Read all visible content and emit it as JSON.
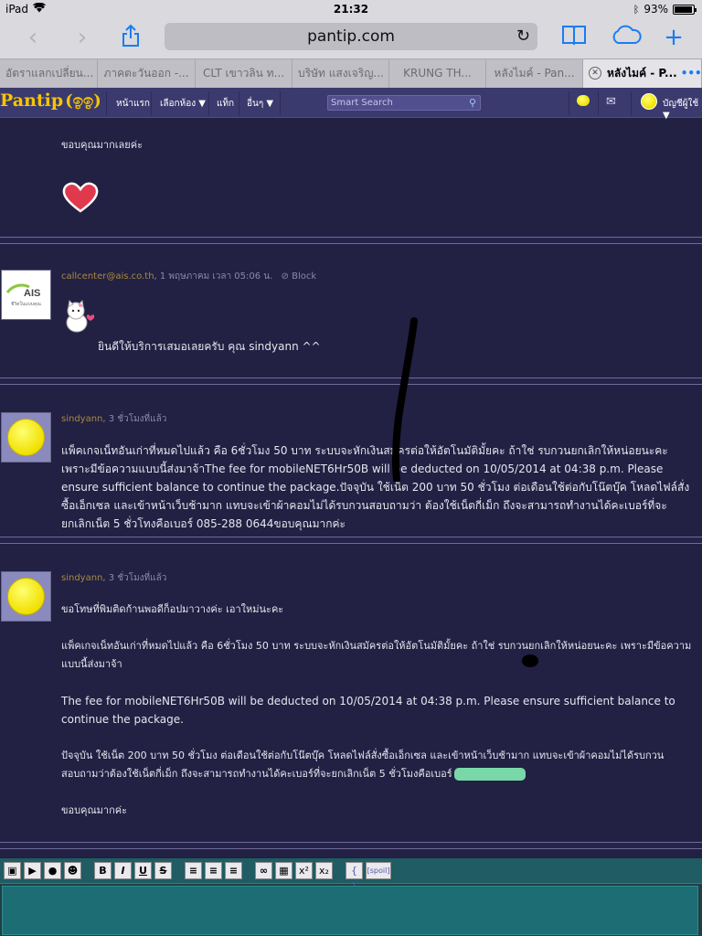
{
  "status_bar": {
    "device": "iPad",
    "time": "21:32",
    "battery": "93%"
  },
  "browser": {
    "url": "pantip.com",
    "icons": [
      "back-icon",
      "forward-icon",
      "share-icon",
      "bookmarks-icon",
      "icloud-icon",
      "new-tab-icon"
    ],
    "tabs": [
      {
        "label": "อัตราแลกเปลี่ยน...",
        "active": false
      },
      {
        "label": "ภาคตะวันออก -...",
        "active": false
      },
      {
        "label": "CLT เขาวลิน ท...",
        "active": false
      },
      {
        "label": "บริษัท แสงเจริญ...",
        "active": false
      },
      {
        "label": "KRUNG TH...",
        "active": false
      },
      {
        "label": "หลังไมค์ - Pan...",
        "active": false
      },
      {
        "label": "หลังไมค์ - P...",
        "active": true
      }
    ]
  },
  "nav": {
    "logo": "Pantip",
    "logo_mark": "(ඉඉ)",
    "home": "หน้าแรก",
    "rooms": "เลือกห้อง ▼",
    "tags": "แท็ก",
    "more": "อื่นๆ ▼",
    "search_placeholder": "Smart Search",
    "account": "บัญชีผู้ใช้ ▼"
  },
  "posts": [
    {
      "id": "post-top",
      "body": "ขอบคุณมากเลยค่ะ",
      "sticker": "heart"
    },
    {
      "id": "post-ais",
      "author": "callcenter@ais.co.th",
      "time": ", 1 พฤษภาคม เวลา 05:06 น.",
      "block_label": "Block",
      "avatar_text": "AIS",
      "avatar_sub": "ชีวิตในแบบคุณ",
      "body": "ยินดีให้บริการเสมอเลยครับ คุณ sindyann ^^"
    },
    {
      "id": "post-sindyann-1",
      "author": "sindyann",
      "time": ", 3 ชั่วโมงที่แล้ว",
      "body": "แพ็คเกจเน็ทอันเก่าที่หมดไปแล้ว คือ 6ชั่วโมง 50 บาท ระบบจะหักเงินสมัครต่อให้อัตโนมัติมั้ยคะ  ถ้าใช่ รบกวนยกเลิกให้หน่อยนะคะ  เพราะมีข้อความแบบนี้ส่งมาจ้าThe fee for mobileNET6Hr50B will be deducted on 10/05/2014 at 04:38 p.m. Please ensure sufficient balance to continue the package.ปัจจุบัน ใช้เน็ต 200 บาท 50 ชั่วโมง ต่อเดือนใช้ต่อกับโน๊ตบุ๊ค โหลดไฟล์สั่งซื้อเอ็กเซล และเข้าหน้าเว็บช้ามาก แทบจะเข้าผ้าคอมไม่ได้รบกวนสอบถามว่า ต้องใช้เน็ตกี่เม็ก ถึงจะสามารถทำงานได้คะเบอร์ที่จะยกเลิกเน็ต 5 ชั่วโทงคือเบอร์ 085-288 0644ขอบคุณมากค่ะ"
    },
    {
      "id": "post-sindyann-2",
      "author": "sindyann",
      "time": ", 3 ชั่วโมงที่แล้ว",
      "para1": "ขอโทษที่พิมติดก้านพอดีก็อปมาวางค่ะ เอาใหม่นะคะ",
      "para2": "แพ็คเกจเน็ทอันเก่าที่หมดไปแล้ว คือ 6ชั่วโมง 50 บาท ระบบจะหักเงินสมัครต่อให้อัตโนมัติมั้ยคะ  ถ้าใช่ รบกวนยกเลิกให้หน่อยนะคะ  เพราะมีข้อความแบบนี้ส่งมาจ้า",
      "para3": "The fee for mobileNET6Hr50B will be deducted on 10/05/2014 at 04:38 p.m. Please ensure sufficient balance to continue the package.",
      "para4": "ปัจจุบัน ใช้เน็ต 200 บาท 50 ชั่วโมง ต่อเดือนใช้ต่อกับโน๊ตบุ๊ค โหลดไฟล์สั่งซื้อเอ็กเซล และเข้าหน้าเว็บช้ามาก แทบจะเข้าผ้าคอมไม่ได้รบกวนสอบถามว่าต้องใช้เน็ตกี่เม็ก ถึงจะสามารถทำงานได้คะเบอร์ที่จะยกเลิกเน็ต 5 ชั่วโมงคือเบอร์",
      "para5": "ขอบคุณมากค่ะ"
    }
  ],
  "editor": {
    "tools": [
      "camera-icon",
      "video-icon",
      "map-pin-icon",
      "emoticon-icon",
      "B",
      "I",
      "U",
      "S",
      "align-left-icon",
      "align-center-icon",
      "align-right-icon",
      "link-icon",
      "table-icon",
      "x²",
      "x₂",
      "{ }",
      "[spoil]"
    ]
  },
  "colors": {
    "page_bg": "#222043",
    "nav_bg": "#3b3a6e",
    "accent": "#f7c500",
    "author": "#a78a3f",
    "ios_blue": "#1a7cf2"
  }
}
